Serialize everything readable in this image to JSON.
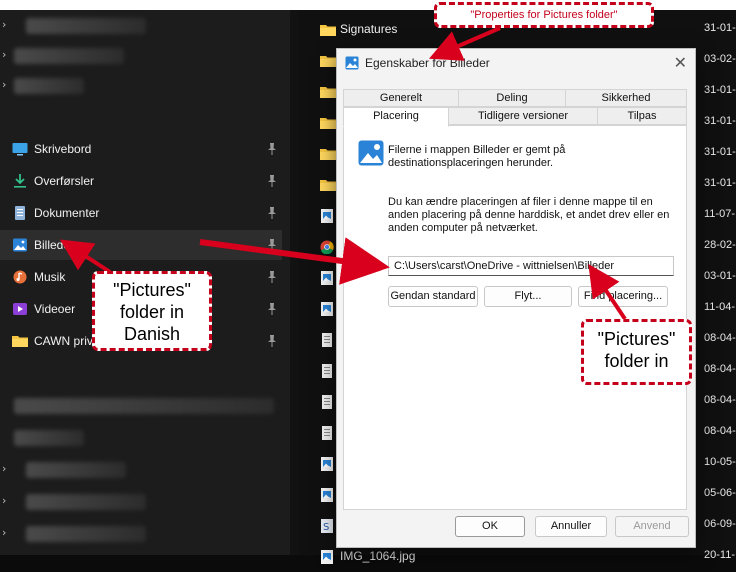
{
  "nav": {
    "items": [
      {
        "label": "Skrivebord",
        "icon": "desktop-icon"
      },
      {
        "label": "Overførsler",
        "icon": "download-icon"
      },
      {
        "label": "Dokumenter",
        "icon": "document-icon"
      },
      {
        "label": "Billeder",
        "icon": "pictures-icon",
        "selected": true
      },
      {
        "label": "Musik",
        "icon": "music-icon"
      },
      {
        "label": "Videoer",
        "icon": "video-icon"
      },
      {
        "label": "CAWN priva",
        "icon": "folder-icon"
      }
    ]
  },
  "files": {
    "rows": [
      {
        "name": "Signatures",
        "date": "31-01-",
        "icon": "folder-icon"
      },
      {
        "name": "",
        "date": "03-02-",
        "icon": "folder-icon"
      },
      {
        "name": "",
        "date": "31-01-",
        "icon": "folder-icon"
      },
      {
        "name": "",
        "date": "31-01-",
        "icon": "folder-icon"
      },
      {
        "name": "",
        "date": "31-01-",
        "icon": "folder-icon"
      },
      {
        "name": "",
        "date": "31-01-",
        "icon": "folder-icon"
      },
      {
        "name": "",
        "date": "11-07-",
        "icon": "image-file-icon"
      },
      {
        "name": "",
        "date": "28-02-",
        "icon": "chrome-icon"
      },
      {
        "name": "",
        "date": "03-01-",
        "icon": "image-file-icon"
      },
      {
        "name": "",
        "date": "11-04-",
        "icon": "image-file-icon"
      },
      {
        "name": "",
        "date": "08-04-",
        "icon": "text-file-icon"
      },
      {
        "name": "",
        "date": "08-04-",
        "icon": "text-file-icon"
      },
      {
        "name": "",
        "date": "08-04-",
        "icon": "text-file-icon"
      },
      {
        "name": "",
        "date": "08-04-",
        "icon": "text-file-icon"
      },
      {
        "name": "",
        "date": "10-05-",
        "icon": "image-file-icon"
      },
      {
        "name": "",
        "date": "05-06-",
        "icon": "image-file-icon"
      },
      {
        "name": "",
        "date": "06-09-",
        "icon": "script-file-icon"
      },
      {
        "name": "IMG_1064.jpg",
        "date": "20-11-",
        "icon": "image-file-icon"
      }
    ]
  },
  "dialog": {
    "title": "Egenskaber for Billeder",
    "tabs_row1": [
      "Generelt",
      "Deling",
      "Sikkerhed"
    ],
    "tabs_row2": [
      "Placering",
      "Tidligere versioner",
      "Tilpas"
    ],
    "active_tab": "Placering",
    "info_line1": "Filerne i mappen Billeder er gemt på",
    "info_line2": "destinationsplaceringen herunder.",
    "desc_line1": "Du kan ændre placeringen af filer i denne mappe til en",
    "desc_line2": "anden placering på denne harddisk, et andet drev eller en",
    "desc_line3": "anden computer på netværket.",
    "path": "C:\\Users\\carst\\OneDrive - wittnielsen\\Billeder",
    "buttons": {
      "restore": "Gendan standard",
      "move": "Flyt...",
      "find": "Find placering..."
    },
    "footer": {
      "ok": "OK",
      "cancel": "Annuller",
      "apply": "Anvend"
    }
  },
  "annotations": {
    "top": "\"Properties for Pictures folder\"",
    "left": [
      "\"Pictures\"",
      "folder in",
      "Danish"
    ],
    "right": [
      "\"Pictures\"",
      "folder in"
    ],
    "color": "#c4001a"
  }
}
